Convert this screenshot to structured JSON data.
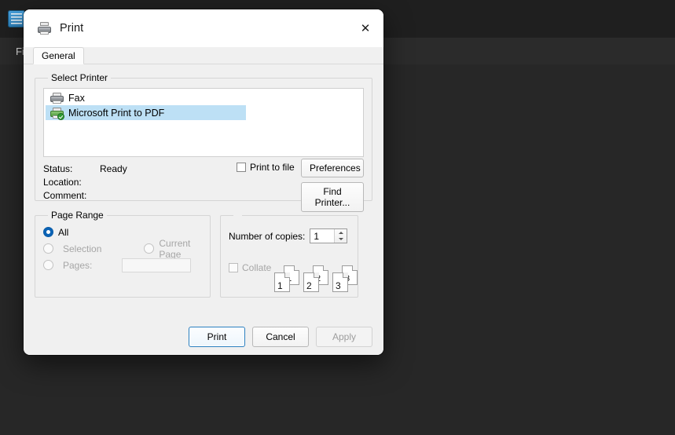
{
  "background": {
    "app_icon": "notepad-icon",
    "menu": {
      "file_label": "File"
    },
    "colors": {
      "titlebar": "#1f1f1f",
      "menubar": "#2b2b2b",
      "content": "#272727"
    }
  },
  "dialog": {
    "title": "Print",
    "title_icon": "printer-icon",
    "close_icon": "✕",
    "tabs": [
      {
        "label": "General",
        "selected": true
      }
    ],
    "select_printer": {
      "legend": "Select Printer",
      "printers": [
        {
          "name": "Fax",
          "icon": "printer-icon",
          "selected": false,
          "default": false
        },
        {
          "name": "Microsoft Print to PDF",
          "icon": "printer-default-icon",
          "selected": true,
          "default": true
        }
      ],
      "status_label": "Status:",
      "status_value": "Ready",
      "location_label": "Location:",
      "location_value": "",
      "comment_label": "Comment:",
      "comment_value": "",
      "print_to_file_label": "Print to file",
      "print_to_file_checked": false,
      "preferences_label": "Preferences",
      "find_printer_label": "Find Printer..."
    },
    "page_range": {
      "legend": "Page Range",
      "options": [
        {
          "label": "All",
          "selected": true,
          "disabled": false
        },
        {
          "label": "Selection",
          "selected": false,
          "disabled": true
        },
        {
          "label": "Current Page",
          "selected": false,
          "disabled": true
        },
        {
          "label": "Pages:",
          "selected": false,
          "disabled": true
        }
      ],
      "pages_value": "",
      "pages_placeholder": ""
    },
    "copies": {
      "number_of_copies_label": "Number of copies:",
      "number_of_copies_value": "1",
      "collate_label": "Collate",
      "collate_checked": false,
      "collate_disabled": true,
      "collate_preview": [
        {
          "front": "1",
          "back": "1"
        },
        {
          "front": "2",
          "back": "2"
        },
        {
          "front": "3",
          "back": "3"
        }
      ]
    },
    "footer": {
      "print_label": "Print",
      "cancel_label": "Cancel",
      "apply_label": "Apply",
      "apply_disabled": true
    },
    "accent_color": "#0b63b5",
    "selection_color": "#bde0f5"
  }
}
